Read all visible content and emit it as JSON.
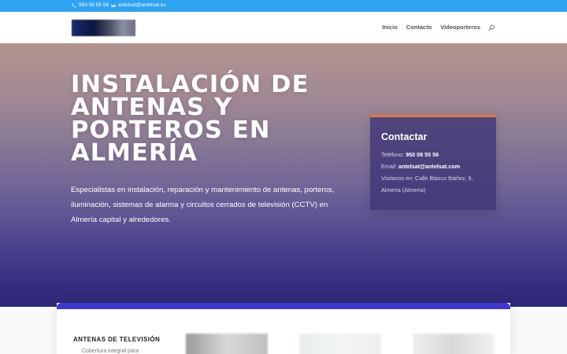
{
  "topbar": {
    "phone": "950 08 55 56",
    "email": "antelsat@antelsat.es",
    "phone_icon": "phone-icon",
    "email_icon": "envelope-icon"
  },
  "header": {
    "logo": "site-logo",
    "nav": [
      "Inicio",
      "Contacto",
      "Videoporteros"
    ],
    "search_icon": "search-icon"
  },
  "hero": {
    "title": "INSTALACIÓN DE ANTENAS Y PORTEROS EN ALMERÍA",
    "description": "Especialistas en instalación, reparación y mantenimiento de antenas, porteros, iluminación, sistemas de alarma y circuitos cerrados de televisión (CCTV) en Almería capital y alrededores."
  },
  "contact": {
    "title": "Contactar",
    "phone_label": "Teléfono:",
    "phone": "950 08 55 56",
    "email_label": "Email:",
    "email": "antelsat@antelsat.com",
    "address_label": "Visitanos en:",
    "address": "Calle Blasco Ibáñez, 9,",
    "city": "Almería (Almería)"
  },
  "services": {
    "first_title": "ANTENAS DE TELEVISIÓN",
    "first_sub": "Cobertura integral para"
  },
  "colors": {
    "topbar": "#2ea3f2",
    "accent_orange": "#e07a3a",
    "band_blue": "#3f39d4"
  }
}
